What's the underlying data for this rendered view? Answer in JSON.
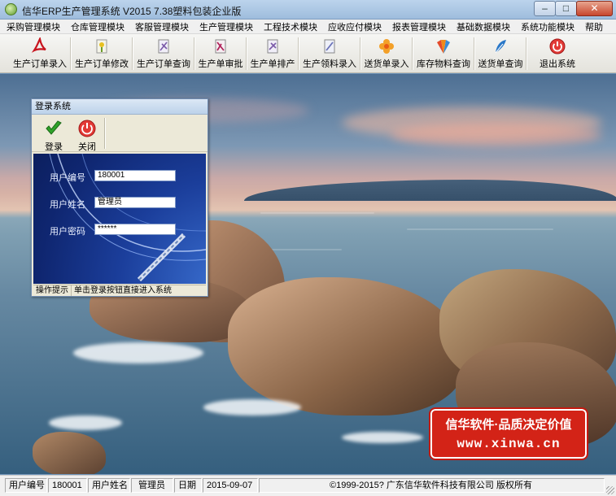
{
  "window": {
    "title": "信华ERP生产管理系统  V2015  7.38塑料包装企业版",
    "minimize": "–",
    "maximize": "□",
    "close": "✕"
  },
  "menu": [
    "采购管理模块",
    "仓库管理模块",
    "客服管理模块",
    "生产管理模块",
    "工程技术模块",
    "应收应付模块",
    "报表管理模块",
    "基础数据模块",
    "系统功能模块",
    "帮助"
  ],
  "toolbar": [
    {
      "label": "生产订单录入",
      "icon": "pdf-icon",
      "color": "#c8141e"
    },
    {
      "label": "生产订单修改",
      "icon": "flower-doc-icon",
      "color": "#6a9a2a"
    },
    {
      "label": "生产订单查询",
      "icon": "document-search-icon",
      "color": "#7a5aa8"
    },
    {
      "label": "生产单审批",
      "icon": "document-approve-icon",
      "color": "#b0245a"
    },
    {
      "label": "生产单排产",
      "icon": "document-schedule-icon",
      "color": "#7a5aa8"
    },
    {
      "label": "生产领料录入",
      "icon": "document-material-icon",
      "color": "#6a72b8"
    },
    {
      "label": "送货单录入",
      "icon": "flower-icon",
      "color": "#e88a14"
    },
    {
      "label": "库存物料查询",
      "icon": "fan-icon",
      "color": "#d8402a"
    },
    {
      "label": "送货单查询",
      "icon": "feather-icon",
      "color": "#2a78c8"
    },
    {
      "label": "退出系统",
      "icon": "power-icon",
      "color": "#d22a2a"
    }
  ],
  "login": {
    "title": "登录系统",
    "login_button": "登录",
    "close_button": "关闭",
    "user_id_label": "用户编号",
    "user_id_value": "180001",
    "user_name_label": "用户姓名",
    "user_name_value": "管理员",
    "password_label": "用户密码",
    "password_value": "******",
    "status_label": "操作提示",
    "status_text": "单击登录按钮直接进入系统"
  },
  "banner": {
    "line1": "信华软件·品质决定价值",
    "line2": "www.xinwa.cn"
  },
  "statusbar": {
    "user_id_label": "用户编号",
    "user_id_value": "180001",
    "user_name_label": "用户姓名",
    "user_name_value": "管理员",
    "date_label": "日期",
    "date_value": "2015-09-07",
    "copyright": "©1999-2015?  广东信华软件科技有限公司  版权所有"
  }
}
